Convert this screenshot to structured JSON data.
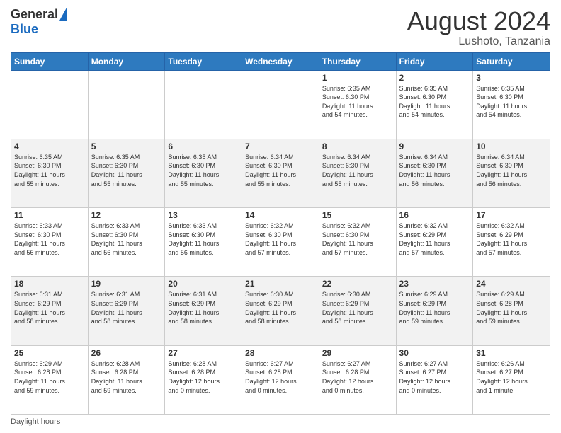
{
  "header": {
    "logo_general": "General",
    "logo_blue": "Blue",
    "main_title": "August 2024",
    "sub_title": "Lushoto, Tanzania"
  },
  "calendar": {
    "days_of_week": [
      "Sunday",
      "Monday",
      "Tuesday",
      "Wednesday",
      "Thursday",
      "Friday",
      "Saturday"
    ],
    "weeks": [
      [
        {
          "day": "",
          "info": ""
        },
        {
          "day": "",
          "info": ""
        },
        {
          "day": "",
          "info": ""
        },
        {
          "day": "",
          "info": ""
        },
        {
          "day": "1",
          "info": "Sunrise: 6:35 AM\nSunset: 6:30 PM\nDaylight: 11 hours\nand 54 minutes."
        },
        {
          "day": "2",
          "info": "Sunrise: 6:35 AM\nSunset: 6:30 PM\nDaylight: 11 hours\nand 54 minutes."
        },
        {
          "day": "3",
          "info": "Sunrise: 6:35 AM\nSunset: 6:30 PM\nDaylight: 11 hours\nand 54 minutes."
        }
      ],
      [
        {
          "day": "4",
          "info": "Sunrise: 6:35 AM\nSunset: 6:30 PM\nDaylight: 11 hours\nand 55 minutes."
        },
        {
          "day": "5",
          "info": "Sunrise: 6:35 AM\nSunset: 6:30 PM\nDaylight: 11 hours\nand 55 minutes."
        },
        {
          "day": "6",
          "info": "Sunrise: 6:35 AM\nSunset: 6:30 PM\nDaylight: 11 hours\nand 55 minutes."
        },
        {
          "day": "7",
          "info": "Sunrise: 6:34 AM\nSunset: 6:30 PM\nDaylight: 11 hours\nand 55 minutes."
        },
        {
          "day": "8",
          "info": "Sunrise: 6:34 AM\nSunset: 6:30 PM\nDaylight: 11 hours\nand 55 minutes."
        },
        {
          "day": "9",
          "info": "Sunrise: 6:34 AM\nSunset: 6:30 PM\nDaylight: 11 hours\nand 56 minutes."
        },
        {
          "day": "10",
          "info": "Sunrise: 6:34 AM\nSunset: 6:30 PM\nDaylight: 11 hours\nand 56 minutes."
        }
      ],
      [
        {
          "day": "11",
          "info": "Sunrise: 6:33 AM\nSunset: 6:30 PM\nDaylight: 11 hours\nand 56 minutes."
        },
        {
          "day": "12",
          "info": "Sunrise: 6:33 AM\nSunset: 6:30 PM\nDaylight: 11 hours\nand 56 minutes."
        },
        {
          "day": "13",
          "info": "Sunrise: 6:33 AM\nSunset: 6:30 PM\nDaylight: 11 hours\nand 56 minutes."
        },
        {
          "day": "14",
          "info": "Sunrise: 6:32 AM\nSunset: 6:30 PM\nDaylight: 11 hours\nand 57 minutes."
        },
        {
          "day": "15",
          "info": "Sunrise: 6:32 AM\nSunset: 6:30 PM\nDaylight: 11 hours\nand 57 minutes."
        },
        {
          "day": "16",
          "info": "Sunrise: 6:32 AM\nSunset: 6:29 PM\nDaylight: 11 hours\nand 57 minutes."
        },
        {
          "day": "17",
          "info": "Sunrise: 6:32 AM\nSunset: 6:29 PM\nDaylight: 11 hours\nand 57 minutes."
        }
      ],
      [
        {
          "day": "18",
          "info": "Sunrise: 6:31 AM\nSunset: 6:29 PM\nDaylight: 11 hours\nand 58 minutes."
        },
        {
          "day": "19",
          "info": "Sunrise: 6:31 AM\nSunset: 6:29 PM\nDaylight: 11 hours\nand 58 minutes."
        },
        {
          "day": "20",
          "info": "Sunrise: 6:31 AM\nSunset: 6:29 PM\nDaylight: 11 hours\nand 58 minutes."
        },
        {
          "day": "21",
          "info": "Sunrise: 6:30 AM\nSunset: 6:29 PM\nDaylight: 11 hours\nand 58 minutes."
        },
        {
          "day": "22",
          "info": "Sunrise: 6:30 AM\nSunset: 6:29 PM\nDaylight: 11 hours\nand 58 minutes."
        },
        {
          "day": "23",
          "info": "Sunrise: 6:29 AM\nSunset: 6:29 PM\nDaylight: 11 hours\nand 59 minutes."
        },
        {
          "day": "24",
          "info": "Sunrise: 6:29 AM\nSunset: 6:28 PM\nDaylight: 11 hours\nand 59 minutes."
        }
      ],
      [
        {
          "day": "25",
          "info": "Sunrise: 6:29 AM\nSunset: 6:28 PM\nDaylight: 11 hours\nand 59 minutes."
        },
        {
          "day": "26",
          "info": "Sunrise: 6:28 AM\nSunset: 6:28 PM\nDaylight: 11 hours\nand 59 minutes."
        },
        {
          "day": "27",
          "info": "Sunrise: 6:28 AM\nSunset: 6:28 PM\nDaylight: 12 hours\nand 0 minutes."
        },
        {
          "day": "28",
          "info": "Sunrise: 6:27 AM\nSunset: 6:28 PM\nDaylight: 12 hours\nand 0 minutes."
        },
        {
          "day": "29",
          "info": "Sunrise: 6:27 AM\nSunset: 6:28 PM\nDaylight: 12 hours\nand 0 minutes."
        },
        {
          "day": "30",
          "info": "Sunrise: 6:27 AM\nSunset: 6:27 PM\nDaylight: 12 hours\nand 0 minutes."
        },
        {
          "day": "31",
          "info": "Sunrise: 6:26 AM\nSunset: 6:27 PM\nDaylight: 12 hours\nand 1 minute."
        }
      ]
    ]
  },
  "footer": {
    "daylight_label": "Daylight hours"
  }
}
